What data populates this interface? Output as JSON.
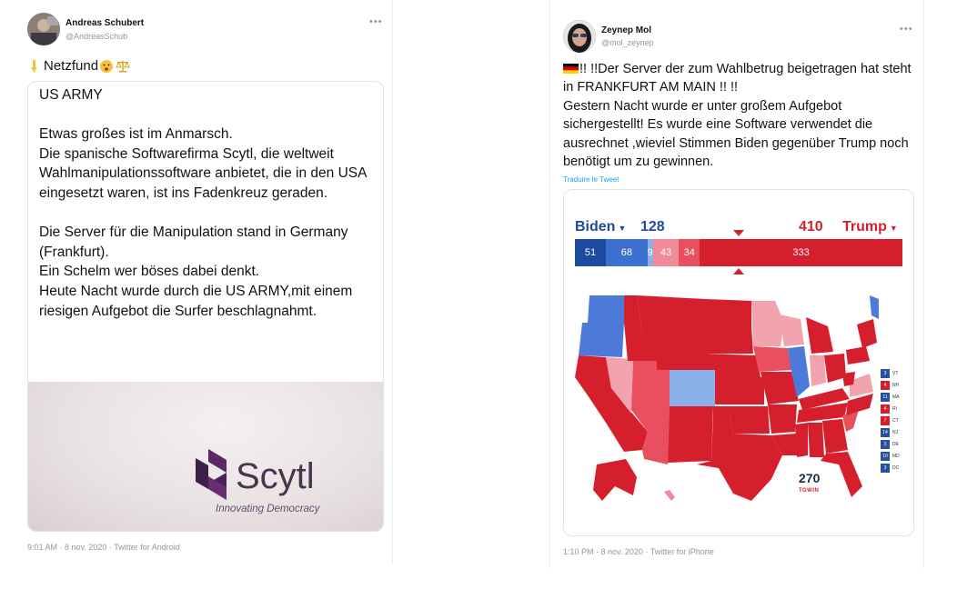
{
  "left_tweet": {
    "name": "Andreas Schubert",
    "handle": "@AndreasSchub",
    "more": "•••",
    "text": "Netzfund",
    "card_text": "US ARMY\n\nEtwas großes ist im Anmarsch.\nDie spanische Softwarefirma Scytl, die weltweit Wahlmanipulationssoftware anbietet, die in den USA eingesetzt waren, ist ins Fadenkreuz geraden.\n\nDie Server für die Manipulation stand in Germany (Frankfurt).\nEin Schelm wer böses dabei denkt.\nHeute Nacht wurde durch die US ARMY,mit einem riesigen Aufgebot die Surfer beschlagnahmt.",
    "logo_word": "Scytl",
    "logo_tagline": "Innovating Democracy",
    "footer": "9:01 AM · 8 nov. 2020 · Twitter for Android",
    "icons": [
      "pointing-down-emoji",
      "astonished-emoji",
      "balance-scale-emoji"
    ]
  },
  "right_tweet": {
    "name": "Zeynep Mol",
    "handle": "@mol_zeynep",
    "more": "•••",
    "text": "!! !!Der Server der zum Wahlbetrug beigetragen hat steht in FRANKFURT AM MAIN !! !!\nGestern Nacht wurde er unter großem Aufgebot sichergestellt! Es wurde eine Software verwendet die ausrechnet ,wieviel Stimmen Biden gegenüber Trump noch benötigt um zu gewinnen.",
    "translate": "Traduire le Tweet",
    "footer": "1:10 PM · 8 nov. 2020 · Twitter for iPhone",
    "icons": [
      "german-flag-emoji"
    ]
  },
  "map": {
    "biden_label": "Biden",
    "biden_total": "128",
    "trump_total": "410",
    "trump_label": "Trump",
    "bar_segments": [
      {
        "label": "51",
        "value": 51,
        "color": "#1c4a9c"
      },
      {
        "label": "68",
        "value": 68,
        "color": "#3b6fd0"
      },
      {
        "label": "9",
        "value": 9,
        "color": "#8ab0ea"
      },
      {
        "label": "43",
        "value": 43,
        "color": "#f08c9a"
      },
      {
        "label": "34",
        "value": 34,
        "color": "#e8505f"
      },
      {
        "label": "333",
        "value": 333,
        "color": "#d61f2c"
      }
    ],
    "small_states": [
      {
        "label": "VT",
        "value": "3",
        "color": "#2850a0"
      },
      {
        "label": "NH",
        "value": "4",
        "color": "#d61f2c"
      },
      {
        "label": "MA",
        "value": "11",
        "color": "#2850a0"
      },
      {
        "label": "RI",
        "value": "4",
        "color": "#d61f2c"
      },
      {
        "label": "CT",
        "value": "7",
        "color": "#d61f2c"
      },
      {
        "label": "NJ",
        "value": "14",
        "color": "#2850a0"
      },
      {
        "label": "DE",
        "value": "3",
        "color": "#2850a0"
      },
      {
        "label": "MD",
        "value": "10",
        "color": "#2850a0"
      },
      {
        "label": "DC",
        "value": "3",
        "color": "#2850a0"
      }
    ],
    "logo_number": "270",
    "logo_text": "TOWIN",
    "colors": {
      "safe_dem": "#2850a0",
      "lean_dem": "#4d7ad8",
      "tilt_dem": "#8ab0ea",
      "tilt_rep": "#f3a3ad",
      "lean_rep": "#e8505f",
      "safe_rep": "#d61f2c"
    }
  }
}
